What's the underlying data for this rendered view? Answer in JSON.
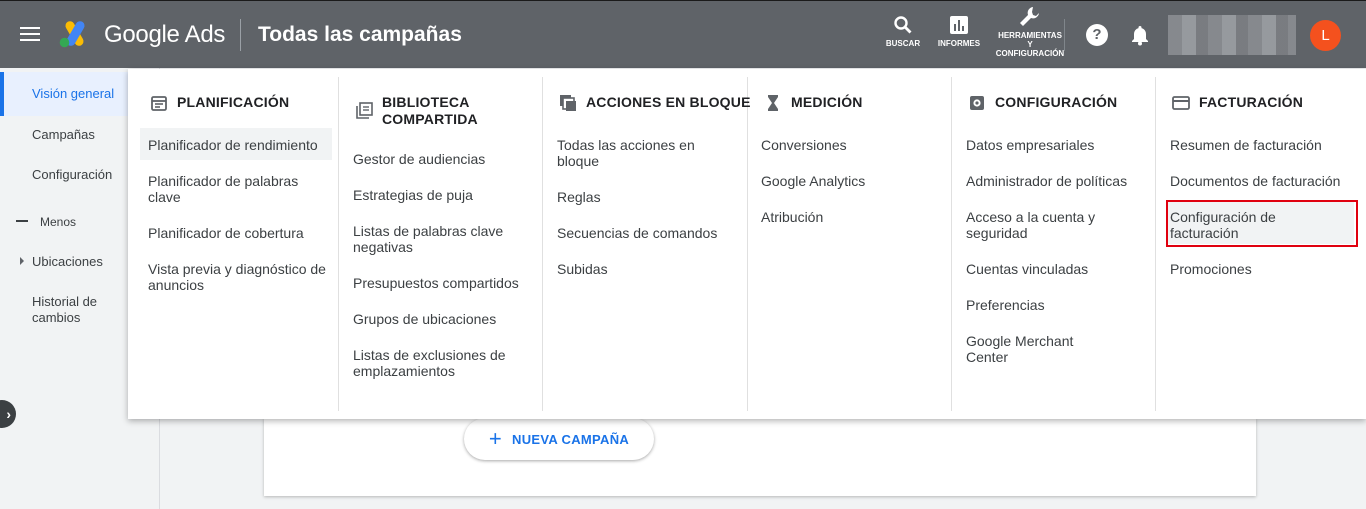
{
  "header": {
    "brand": "Google Ads",
    "title": "Todas las campañas",
    "tools": {
      "search": "BUSCAR",
      "reports": "INFORMES",
      "tools_line1": "HERRAMIENTAS",
      "tools_line2": "Y",
      "tools_line3": "CONFIGURACIÓN"
    },
    "help_glyph": "?",
    "avatar_initial": "L",
    "colors": {
      "header_bg": "#5f6368",
      "avatar": "#f4511e"
    }
  },
  "leftnav": {
    "items": [
      {
        "label": "Visión general",
        "active": true
      },
      {
        "label": "Campañas"
      },
      {
        "label": "Configuración"
      },
      {
        "label": "Menos"
      },
      {
        "label": "Ubicaciones"
      },
      {
        "label": "Historial de cambios"
      }
    ]
  },
  "main": {
    "new_campaign": "NUEVA CAMPAÑA"
  },
  "menu": {
    "columns": [
      {
        "icon": "calendar-icon",
        "heading": "PLANIFICACIÓN",
        "items": [
          "Planificador de rendimiento",
          "Planificador de palabras clave",
          "Planificador de cobertura",
          "Vista previa y diagnóstico de anuncios"
        ]
      },
      {
        "icon": "library-icon",
        "heading": "BIBLIOTECA COMPARTIDA",
        "items": [
          "Gestor de audiencias",
          "Estrategias de puja",
          "Listas de palabras clave negativas",
          "Presupuestos compartidos",
          "Grupos de ubicaciones",
          "Listas de exclusiones de emplazamientos"
        ]
      },
      {
        "icon": "bulk-actions-icon",
        "heading": "ACCIONES EN BLOQUE",
        "items": [
          "Todas las acciones en bloque",
          "Reglas",
          "Secuencias de comandos",
          "Subidas"
        ]
      },
      {
        "icon": "hourglass-icon",
        "heading": "MEDICIÓN",
        "items": [
          "Conversiones",
          "Google Analytics",
          "Atribución"
        ]
      },
      {
        "icon": "gear-icon",
        "heading": "CONFIGURACIÓN",
        "items": [
          "Datos empresariales",
          "Administrador de políticas",
          "Acceso a la cuenta y seguridad",
          "Cuentas vinculadas",
          "Preferencias",
          "Google Merchant Center"
        ]
      },
      {
        "icon": "credit-card-icon",
        "heading": "FACTURACIÓN",
        "items": [
          "Resumen de facturación",
          "Documentos de facturación",
          "Configuración de facturación",
          "Promociones"
        ]
      }
    ],
    "highlighted_item": "Planificador de rendimiento",
    "selected_item": "Configuración de facturación"
  }
}
